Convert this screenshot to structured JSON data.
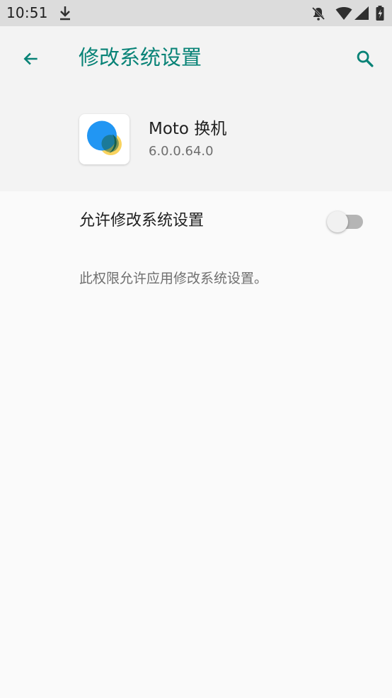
{
  "status_bar": {
    "time": "10:51",
    "icons": [
      "download-icon",
      "do-not-disturb-icon",
      "wifi-icon",
      "signal-icon",
      "battery-icon"
    ]
  },
  "header": {
    "title": "修改系统设置",
    "back_icon": "back-arrow-icon",
    "search_icon": "search-icon",
    "accent_color": "#078276"
  },
  "app": {
    "name": "Moto 换机",
    "version": "6.0.0.64.0",
    "icon": "moto-migrate-app-icon"
  },
  "setting": {
    "label": "允许修改系统设置",
    "enabled": false,
    "description": "此权限允许应用修改系统设置。"
  },
  "colors": {
    "background": "#fafafa",
    "header_background": "#f3f3f3",
    "status_bar_background": "#dcdcdc"
  }
}
